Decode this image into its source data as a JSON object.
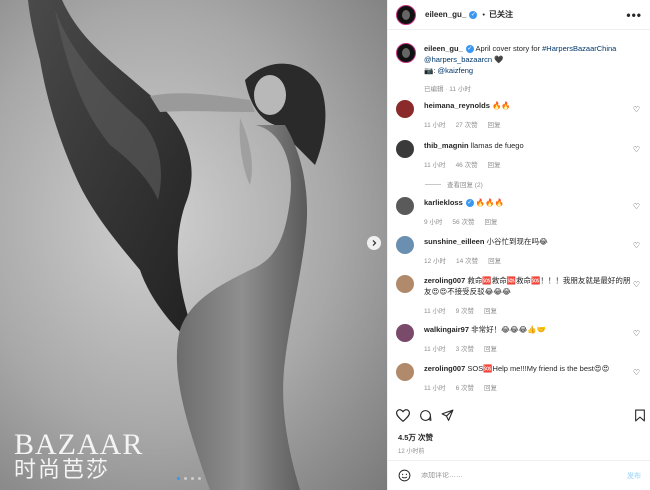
{
  "photo": {
    "watermark_latin": "BAZAAR",
    "watermark_cn": "时尚芭莎",
    "dot_count": 4,
    "active_dot": 0
  },
  "header": {
    "username": "eileen_gu_",
    "separator": "•",
    "follow_label": "已关注",
    "more_label": "•••"
  },
  "caption": {
    "username": "eileen_gu_",
    "text": " April cover story for ",
    "hashtag": "#HarpersBazaarChina",
    "mention": "@harpers_bazaarcn",
    "heart": "🖤",
    "camera": "📷",
    "separator": ":",
    "photographer": "@kaizfeng",
    "meta_edited": "已编辑",
    "meta_dot": "·",
    "meta_time": "11 小时"
  },
  "comments": [
    {
      "username": "heimana_reynolds",
      "text": "🔥🔥",
      "time": "11 小时",
      "likes": "27 次赞",
      "reply": "回复",
      "avatar_color": "#8b2a2a",
      "verified": false
    },
    {
      "username": "thib_magnin",
      "text": "llamas de fuego",
      "time": "11 小时",
      "likes": "46 次赞",
      "reply": "回复",
      "avatar_color": "#3a3a3a",
      "verified": false
    },
    {
      "username": "karliekloss",
      "text": "🔥🔥🔥",
      "time": "9 小时",
      "likes": "56 次赞",
      "reply": "回复",
      "avatar_color": "#5a5a5a",
      "verified": true
    },
    {
      "username": "sunshine_eilleen",
      "text": "小谷忙到现在吗😂",
      "time": "12 小时",
      "likes": "14 次赞",
      "reply": "回复",
      "avatar_color": "#6a8fb0",
      "verified": false
    },
    {
      "username": "zeroling007",
      "text": "救命🆘救命🆘救命🆘！！！我朋友就是最好的朋友😍😍不接受反驳😂😂😂",
      "time": "11 小时",
      "likes": "9 次赞",
      "reply": "回复",
      "avatar_color": "#b08a6a",
      "verified": false
    },
    {
      "username": "walkingair97",
      "text": "非常好！😂😂😂👍🤝",
      "time": "11 小时",
      "likes": "3 次赞",
      "reply": "回复",
      "avatar_color": "#7a4a6a",
      "verified": false
    },
    {
      "username": "zeroling007",
      "text": "SOS🆘Help me!!!My friend is the best😍😍",
      "time": "11 小时",
      "likes": "6 次赞",
      "reply": "回复",
      "avatar_color": "#b08a6a",
      "verified": false
    }
  ],
  "view_replies": "查看回复 (2)",
  "likes_count": "4.5万 次赞",
  "post_time": "12 小时前",
  "add_comment": {
    "placeholder": "添加评论……",
    "post_label": "发布"
  }
}
